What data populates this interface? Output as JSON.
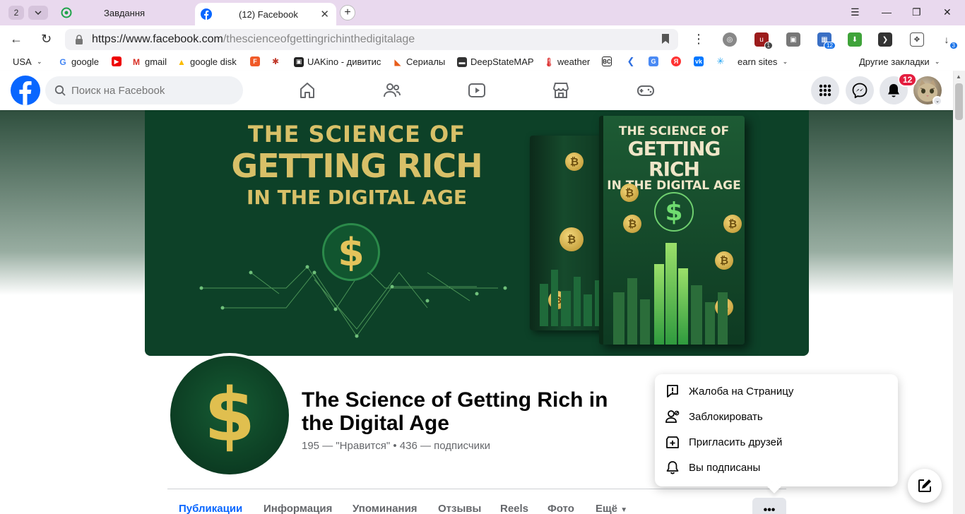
{
  "browser": {
    "tab_count": "2",
    "tabs": [
      {
        "title": "Завдання",
        "active": false
      },
      {
        "title": "(12) Facebook",
        "active": true
      }
    ],
    "url_host": "https://www.facebook.com",
    "url_path": "/thescienceofgettingrichinthedigitalage",
    "ext_badge_12": "12",
    "ext_badge_3": "3",
    "bookmarks": [
      "USA",
      "google",
      "gmail",
      "google disk",
      "UAKino - дивитис",
      "Сериалы",
      "DeepStateMAP",
      "weather",
      "earn sites",
      "Другие закладки"
    ]
  },
  "fb": {
    "search_placeholder": "Поиск на Facebook",
    "notifications_count": "12"
  },
  "cover": {
    "title_line1": "THE SCIENCE OF",
    "title_line2": "GETTING RICH",
    "title_line3": "IN THE DIGITAL AGE",
    "dollar": "$",
    "book_title_a": "THE SCIENCE OF",
    "book_title_b": "GETTING RICH",
    "book_title_c": "IN THE DIGITAL AGE"
  },
  "profile": {
    "name": "The Science of Getting Rich in the Digital Age",
    "stats": "195 — \"Нравится\" • 436 — подписчики",
    "dollar": "$"
  },
  "page_tabs": [
    "Публикации",
    "Информация",
    "Упоминания",
    "Отзывы",
    "Reels",
    "Фото",
    "Ещё"
  ],
  "more_button": "•••",
  "dropdown": {
    "items": [
      {
        "label": "Жалоба на Страницу",
        "icon": "report-icon"
      },
      {
        "label": "Заблокировать",
        "icon": "block-user-icon"
      },
      {
        "label": "Пригласить друзей",
        "icon": "invite-icon"
      },
      {
        "label": "Вы подписаны",
        "icon": "bell-icon"
      }
    ]
  },
  "colors": {
    "fb_blue": "#0866ff",
    "cover_green": "#0d4128",
    "gold": "#d8c068",
    "badge_red": "#e41e3f"
  }
}
